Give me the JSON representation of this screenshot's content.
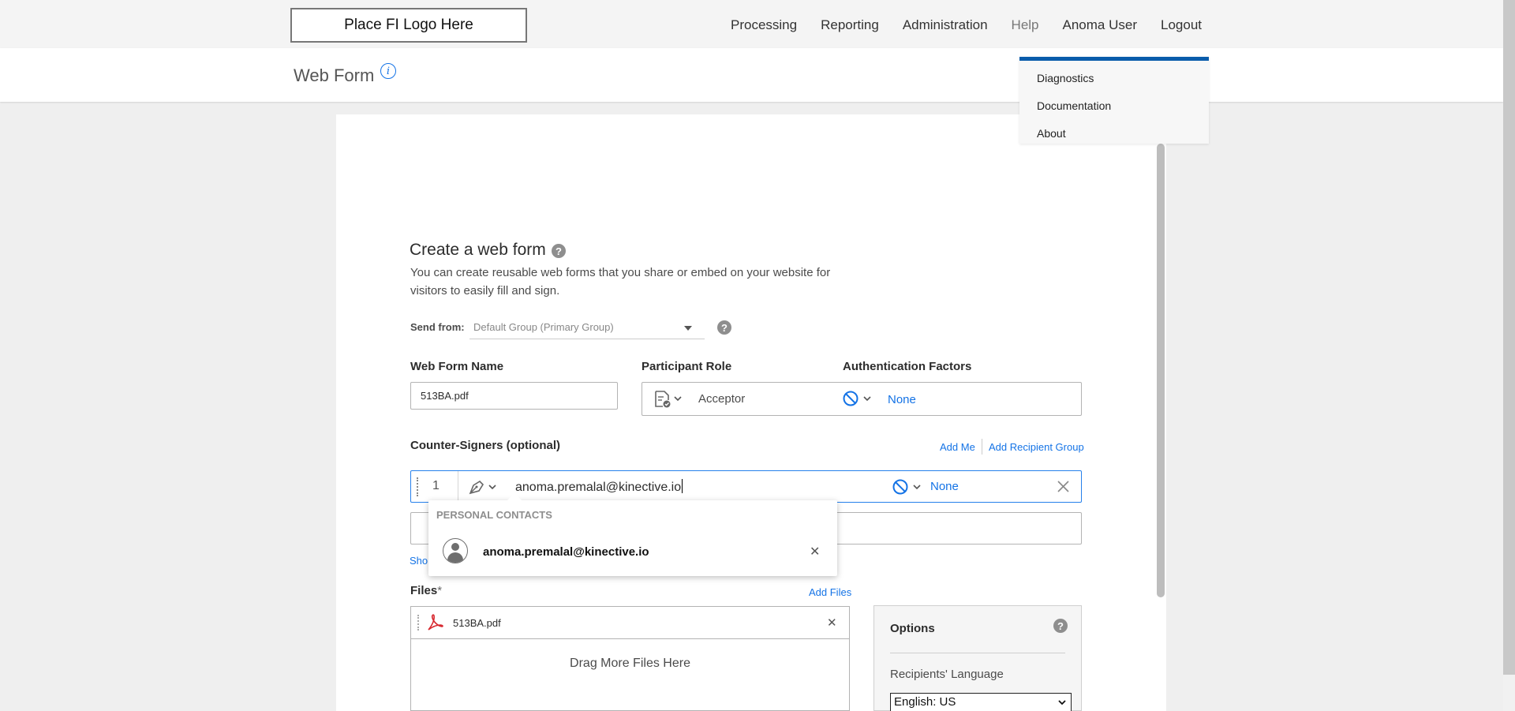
{
  "topbar": {
    "logo": "Place FI Logo Here",
    "nav": [
      "Processing",
      "Reporting",
      "Administration",
      "Help",
      "Anoma User",
      "Logout"
    ]
  },
  "subheader": {
    "title": "Web Form"
  },
  "help_menu": {
    "items": [
      "Diagnostics",
      "Documentation",
      "About"
    ]
  },
  "form": {
    "heading": "Create a web form",
    "description": "You can create reusable web forms that you share or embed on your website for visitors to easily fill and sign.",
    "send_from": {
      "label": "Send from:",
      "value": "Default Group (Primary Group)"
    },
    "web_form_name": {
      "label": "Web Form Name",
      "value": "513BA.pdf"
    },
    "participant_role": {
      "label": "Participant Role",
      "value": "Acceptor"
    },
    "auth_factors": {
      "label": "Authentication Factors",
      "value": "None"
    },
    "counter_signers": {
      "label": "Counter-Signers (optional)",
      "add_me": "Add Me",
      "add_group": "Add Recipient Group",
      "row": {
        "number": "1",
        "email": "anoma.premalal@kinective.io",
        "auth": "None"
      }
    },
    "autocomplete": {
      "header": "PERSONAL CONTACTS",
      "contact": "anoma.premalal@kinective.io"
    },
    "show_link": "Sho",
    "files": {
      "label": "Files",
      "required_mark": "*",
      "add_files": "Add Files",
      "file_name": "513BA.pdf",
      "drag_text": "Drag More Files Here"
    },
    "options": {
      "title": "Options",
      "language_label": "Recipients' Language",
      "language_value": "English: US"
    }
  },
  "colors": {
    "accent": "#1473e6",
    "menu_bar": "#0a5cab",
    "pdf_red": "#d7282f"
  }
}
